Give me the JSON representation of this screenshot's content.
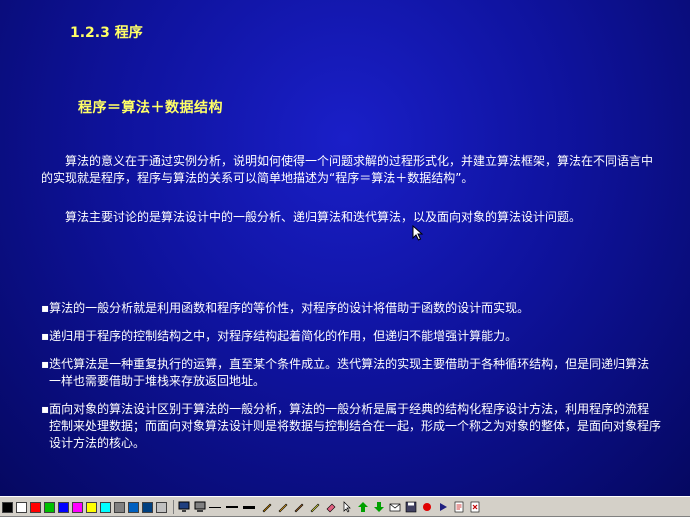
{
  "slide": {
    "section_title": "1.2.3 程序",
    "subtitle": "程序＝算法＋数据结构",
    "paragraphs": [
      "算法的意义在于通过实例分析，说明如何使得一个问题求解的过程形式化，并建立算法框架，算法在不同语言中的实现就是程序，程序与算法的关系可以简单地描述为“程序＝算法＋数据结构”。",
      "算法主要讨论的是算法设计中的一般分析、递归算法和迭代算法，以及面向对象的算法设计问题。"
    ],
    "bullets": [
      "算法的一般分析就是利用函数和程序的等价性，对程序的设计将借助于函数的设计而实现。",
      "递归用于程序的控制结构之中，对程序结构起着简化的作用，但递归不能增强计算能力。",
      "迭代算法是一种重复执行的运算，直至某个条件成立。迭代算法的实现主要借助于各种循环结构，但是同递归算法一样也需要借助于堆栈来存放返回地址。",
      "面向对象的算法设计区别于算法的一般分析，算法的一般分析是属于经典的结构化程序设计方法，利用程序的流程控制来处理数据；而面向对象算法设计则是将数据与控制结合在一起，形成一个称之为对象的整体，是面向对象程序设计方法的核心。"
    ]
  },
  "colors": {
    "title": "#ffff66",
    "text": "#ffffff",
    "background": "#0f139e",
    "toolbar": "#d4d0c8"
  },
  "toolbar": {
    "swatches": [
      "#000000",
      "#ffffff",
      "#ff0000",
      "#00c000",
      "#0000ff",
      "#ff00ff",
      "#ffff00",
      "#00ffff",
      "#808080",
      "#0060c0",
      "#004080",
      "#c0c0c0"
    ],
    "icons": [
      "monitor-icon",
      "display-icon",
      "thin-line-icon",
      "medium-line-icon",
      "thick-line-icon",
      "pen-icon",
      "marker-icon",
      "brush-icon",
      "highlighter-icon",
      "eraser-icon",
      "pointer-icon",
      "arrow-up-icon",
      "arrow-down-icon",
      "mail-icon",
      "save-icon",
      "record-icon",
      "play-icon",
      "page-icon",
      "exit-icon"
    ]
  }
}
